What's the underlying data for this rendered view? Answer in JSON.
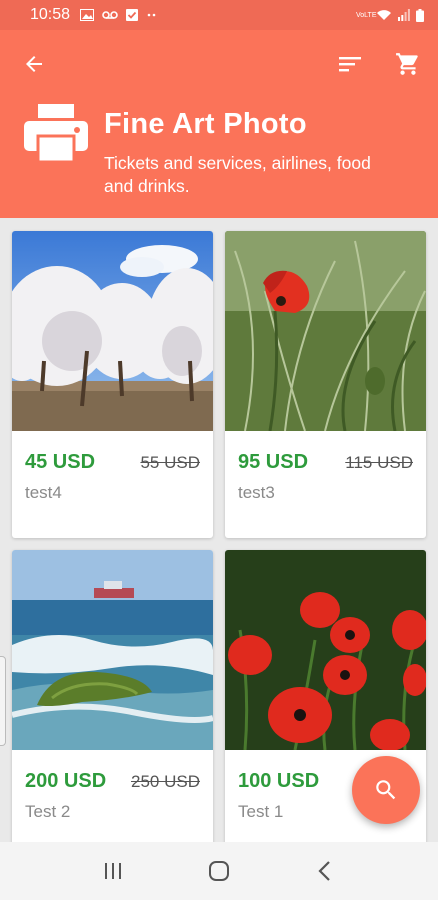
{
  "status_bar": {
    "time": "10:58",
    "left_icons": [
      "image-icon",
      "voicemail-icon",
      "check-box-icon",
      "more-dots-icon"
    ],
    "right_icons": [
      "volte-icon",
      "wifi-icon",
      "signal-icon",
      "battery-icon"
    ],
    "volte_label": "VoLTE"
  },
  "header": {
    "title": "Fine Art Photo",
    "subtitle": "Tickets and services, airlines, food and drinks.",
    "icon": "printer-icon",
    "background_color": "#fb7359"
  },
  "toolbar": {
    "back_icon": "arrow-back-icon",
    "sort_icon": "sort-icon",
    "cart_icon": "shopping-cart-icon"
  },
  "products": [
    {
      "price": "45 USD",
      "old_price": "55 USD",
      "name": "test4",
      "image": "almond-blossom-orchard"
    },
    {
      "price": "95 USD",
      "old_price": "115 USD",
      "name": "test3",
      "image": "red-poppy-in-grass"
    },
    {
      "price": "200 USD",
      "old_price": "250 USD",
      "name": "Test 2",
      "image": "sea-waves-with-ship"
    },
    {
      "price": "100 USD",
      "old_price": "",
      "name": "Test 1",
      "image": "red-poppy-field"
    }
  ],
  "fab": {
    "icon": "search-icon"
  },
  "colors": {
    "accent": "#fb7359",
    "price": "#2e9b3c",
    "status_bar": "#ef6a55"
  },
  "nav_bar": {
    "icons": [
      "recent-apps-icon",
      "home-icon",
      "back-nav-icon"
    ]
  }
}
